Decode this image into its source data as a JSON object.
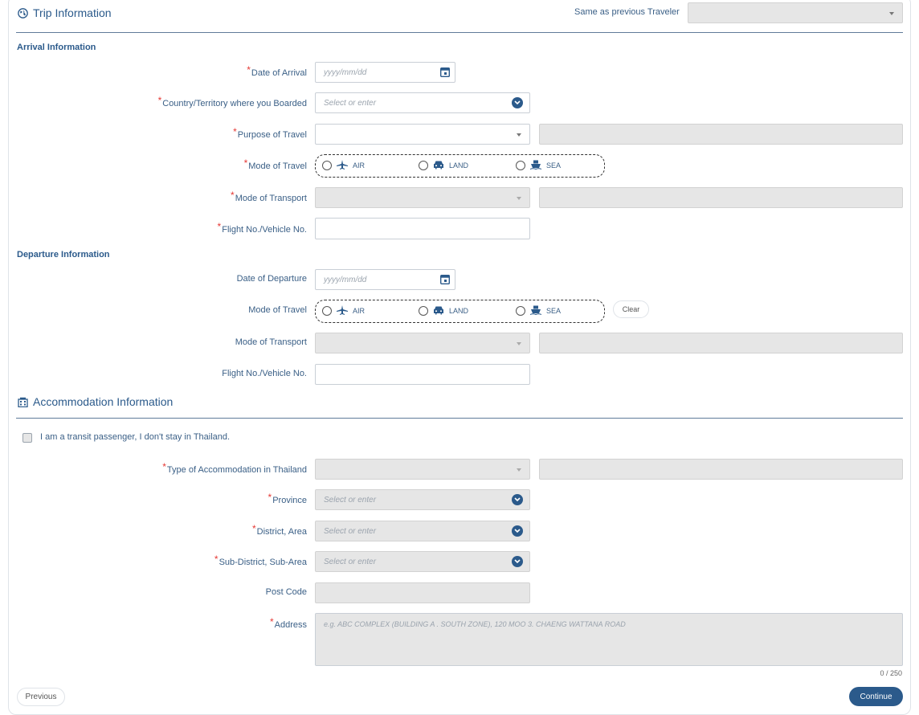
{
  "trip": {
    "title": "Trip Information",
    "same_as_label": "Same as previous Traveler",
    "same_as_value": ""
  },
  "arrival": {
    "title": "Arrival Information",
    "date_label": "Date of Arrival",
    "date_placeholder": "yyyy/mm/dd",
    "country_label": "Country/Territory where you Boarded",
    "country_placeholder": "Select or enter",
    "purpose_label": "Purpose of Travel",
    "mode_label": "Mode of Travel",
    "transport_label": "Mode of Transport",
    "flight_label": "Flight No./Vehicle No."
  },
  "travel_modes": {
    "air": "AIR",
    "land": "LAND",
    "sea": "SEA"
  },
  "departure": {
    "title": "Departure Information",
    "date_label": "Date of Departure",
    "date_placeholder": "yyyy/mm/dd",
    "mode_label": "Mode of Travel",
    "clear_label": "Clear",
    "transport_label": "Mode of Transport",
    "flight_label": "Flight No./Vehicle No."
  },
  "accommodation": {
    "title": "Accommodation Information",
    "transit_label": "I am a transit passenger, I don't stay in Thailand.",
    "type_label": "Type of Accommodation in Thailand",
    "province_label": "Province",
    "district_label": "District, Area",
    "subdistrict_label": "Sub-District, Sub-Area",
    "select_placeholder": "Select or enter",
    "postcode_label": "Post Code",
    "address_label": "Address",
    "address_placeholder": "e.g. ABC COMPLEX (BUILDING A . SOUTH ZONE), 120 MOO 3. CHAENG WATTANA ROAD",
    "char_count": "0 / 250"
  },
  "footer": {
    "previous_label": "Previous",
    "continue_label": "Continue"
  },
  "required_mark": "*",
  "colors": {
    "primary": "#2b5a8b",
    "required": "#e53935",
    "disabled": "#e6e6e6"
  }
}
